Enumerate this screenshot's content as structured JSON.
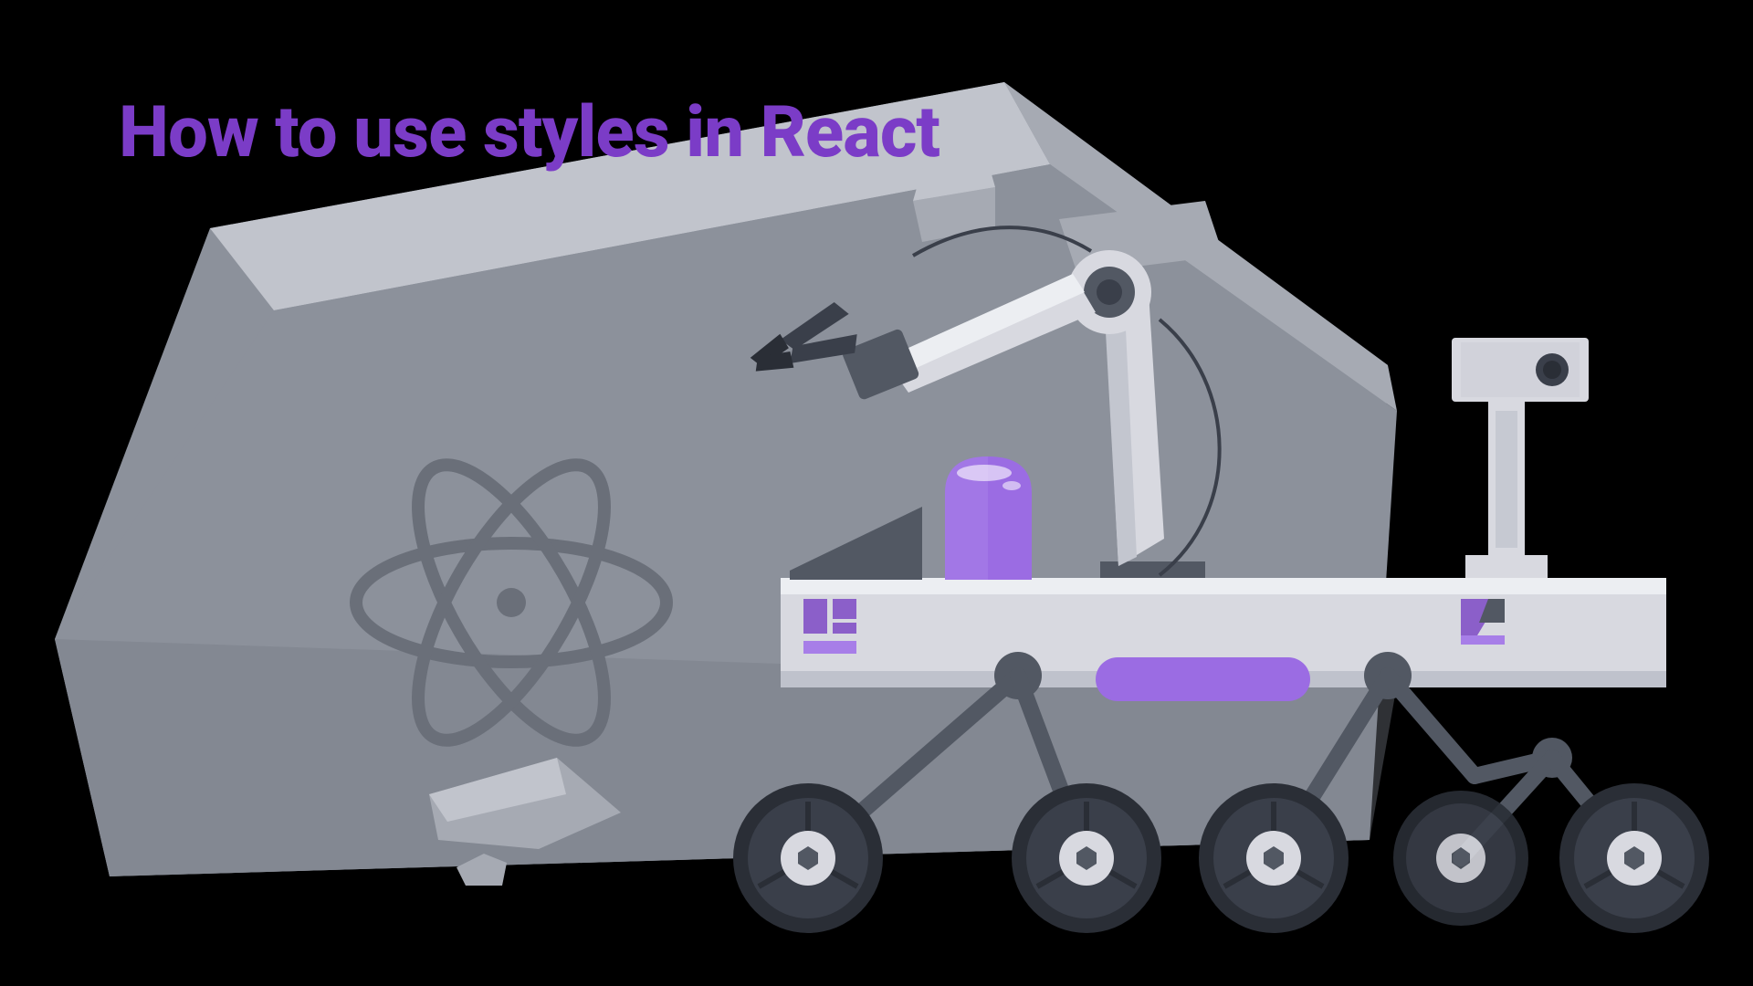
{
  "title": "How to use styles in React",
  "colors": {
    "title": "#7b3cc7",
    "accent": "#9b6ce3",
    "accent_light": "#a77ee8",
    "rock_light": "#c1c4cc",
    "rock_mid": "#a6aab3",
    "rock_dark": "#8c919b",
    "rock_shadow": "#767b85",
    "rover_body": "#d8d9e0",
    "rover_dark": "#525863",
    "wheel": "#3a3f4a",
    "wheel_inner": "#2a2e36"
  }
}
